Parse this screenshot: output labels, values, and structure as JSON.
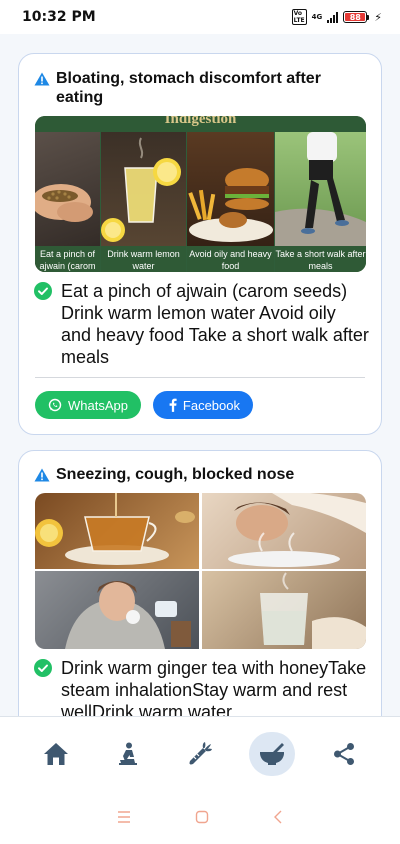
{
  "status_bar": {
    "time": "10:32 PM",
    "volte": "VoLTE",
    "network": "4G",
    "battery": "88"
  },
  "cards": [
    {
      "title": "Bloating, stomach discomfort after eating",
      "banner_text": "Indigestion",
      "panels": [
        {
          "caption": "Eat a pinch of ajwain (carom seeds)",
          "icon": "ajwain-seeds-photo"
        },
        {
          "caption": "Drink warm lemon water",
          "icon": "lemon-water-photo"
        },
        {
          "caption": "Avoid oily and heavy food",
          "icon": "fried-food-photo"
        },
        {
          "caption": "Take a short walk after meals",
          "icon": "walking-photo"
        }
      ],
      "description": "Eat a pinch of ajwain (carom seeds) Drink warm lemon water Avoid oily and heavy food Take a short walk after meals",
      "share": {
        "whatsapp": "WhatsApp",
        "facebook": "Facebook"
      }
    },
    {
      "title": "Sneezing, cough, blocked nose",
      "panels": [
        {
          "icon": "ginger-tea-photo"
        },
        {
          "icon": "steam-inhalation-photo"
        },
        {
          "icon": "blanket-rest-photo"
        },
        {
          "icon": "warm-water-photo"
        }
      ],
      "description": "Drink warm ginger tea with honeyTake steam inhalationStay warm and rest wellDrink warm water"
    }
  ],
  "nav": {
    "items": [
      "home-icon",
      "meditation-icon",
      "carrot-icon",
      "mortar-pestle-icon",
      "share-icon"
    ],
    "active_index": 3
  },
  "colors": {
    "card_border": "#c9d7ee",
    "warning": "#1e88e5",
    "check": "#21c065",
    "whatsapp": "#21c065",
    "facebook": "#1877f2",
    "nav_icon": "#3f5870",
    "nav_active_bg": "#dde7f3"
  }
}
